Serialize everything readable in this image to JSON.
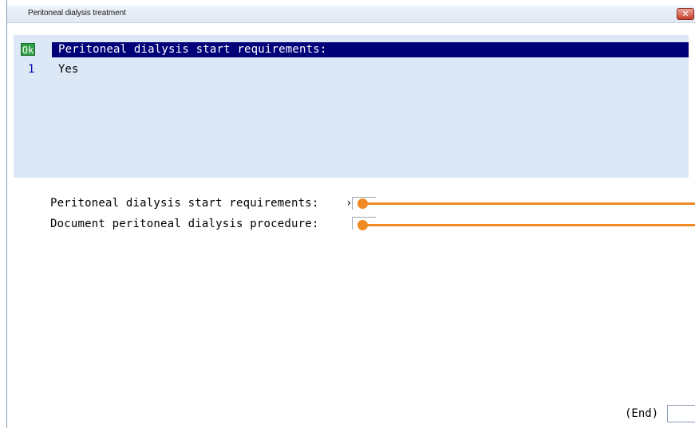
{
  "window": {
    "title": "Peritoneal dialysis treatment",
    "close_glyph": "✕"
  },
  "list": {
    "ok_label": "Ok",
    "header": "Peritoneal dialysis start requirements:",
    "options": [
      {
        "number": "1",
        "label": "Yes"
      }
    ]
  },
  "form": {
    "fields": [
      {
        "label": "Peritoneal dialysis start requirements:",
        "value": "›"
      },
      {
        "label": "Document peritoneal dialysis procedure:",
        "value": ""
      }
    ]
  },
  "footer": {
    "end_label": "(End)"
  },
  "colors": {
    "selection": "#000078",
    "panel": "#dde8f7",
    "ok": "#2f9e44",
    "annotation": "#f08a24"
  }
}
